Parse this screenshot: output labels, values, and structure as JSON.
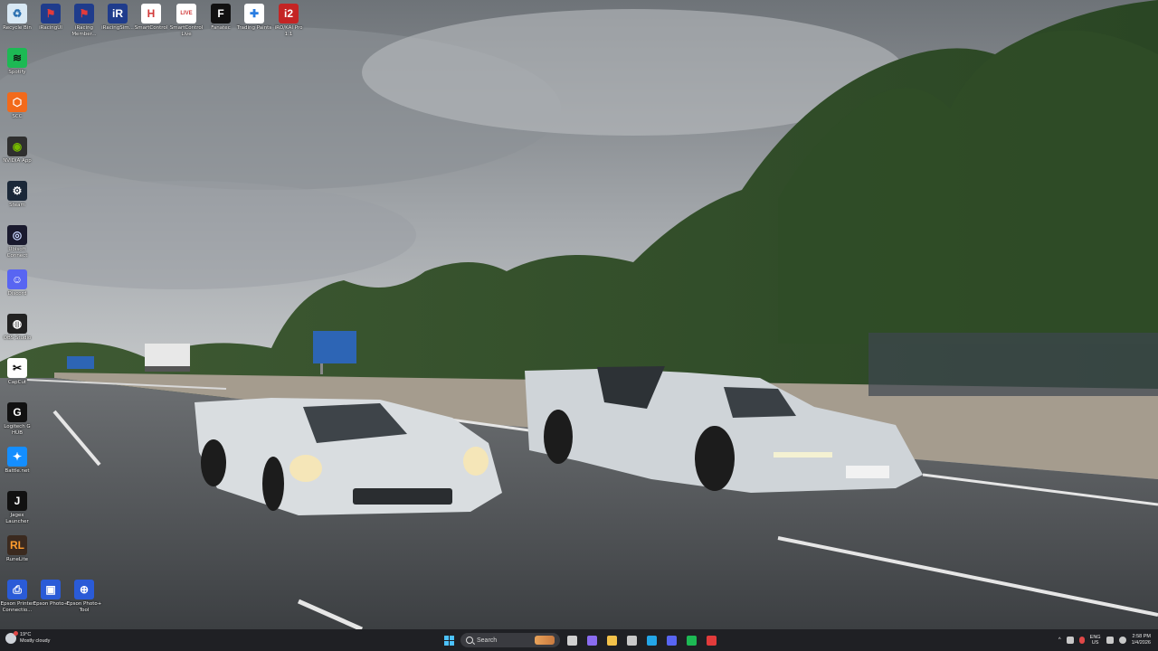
{
  "desktop_icons": [
    {
      "label": "Recycle Bin",
      "color": "#d8e8f4",
      "glyph": "♻",
      "fg": "#2a6fb0"
    },
    {
      "label": "iRacingUI",
      "color": "#1f3c8c",
      "glyph": "⚑",
      "fg": "#e23b3b"
    },
    {
      "label": "iRacing Member...",
      "color": "#1f3c8c",
      "glyph": "⚑",
      "fg": "#e23b3b"
    },
    {
      "label": "iRacingSim...",
      "color": "#1f3c8c",
      "glyph": "iR",
      "fg": "#ffffff"
    },
    {
      "label": "SmartControl",
      "color": "#ffffff",
      "glyph": "H",
      "fg": "#d23a3a"
    },
    {
      "label": "SmartControl Live",
      "color": "#ffffff",
      "glyph": "LIVE",
      "fg": "#d23a3a"
    },
    {
      "label": "Fanatec",
      "color": "#111111",
      "glyph": "F",
      "fg": "#ffffff"
    },
    {
      "label": "Trading Paints",
      "color": "#ffffff",
      "glyph": "✚",
      "fg": "#2a7de1"
    },
    {
      "label": "iRO/KAI Pro 1.1",
      "color": "#c42424",
      "glyph": "i2",
      "fg": "#ffffff"
    },
    {
      "label": "Spotify",
      "color": "#1db954",
      "glyph": "≋",
      "fg": "#111111"
    },
    {
      "label": "SCC",
      "color": "#f26a1b",
      "glyph": "⬡",
      "fg": "#ffffff"
    },
    {
      "label": "NVIDIA App",
      "color": "#2f2f2f",
      "glyph": "◉",
      "fg": "#76b900"
    },
    {
      "label": "Steam",
      "color": "#1b2838",
      "glyph": "⚙",
      "fg": "#ffffff"
    },
    {
      "label": "Ubisoft Connect",
      "color": "#1a1a2e",
      "glyph": "◎",
      "fg": "#c9d6ff"
    },
    {
      "label": "Discord",
      "color": "#5865f2",
      "glyph": "☺",
      "fg": "#ffffff"
    },
    {
      "label": "OBS Studio",
      "color": "#222222",
      "glyph": "◍",
      "fg": "#ffffff"
    },
    {
      "label": "CapCut",
      "color": "#ffffff",
      "glyph": "✂",
      "fg": "#000000"
    },
    {
      "label": "Logitech G HUB",
      "color": "#111111",
      "glyph": "G",
      "fg": "#ffffff"
    },
    {
      "label": "Battle.net",
      "color": "#148eff",
      "glyph": "✦",
      "fg": "#ffffff"
    },
    {
      "label": "Jagex Launcher",
      "color": "#111111",
      "glyph": "J",
      "fg": "#ffffff"
    },
    {
      "label": "RuneLite",
      "color": "#3b2a1f",
      "glyph": "RL",
      "fg": "#ff9d2e"
    },
    {
      "label": "Epson Printer Connectio...",
      "color": "#2a5bd7",
      "glyph": "⎙",
      "fg": "#ffffff"
    },
    {
      "label": "Epson Photo+",
      "color": "#2a5bd7",
      "glyph": "▣",
      "fg": "#ffffff"
    },
    {
      "label": "Epson Photo+ Tool",
      "color": "#2a5bd7",
      "glyph": "⊕",
      "fg": "#ffffff"
    }
  ],
  "taskbar": {
    "weather_temp": "19°C",
    "weather_desc": "Mostly cloudy",
    "search_placeholder": "Search",
    "apps": [
      {
        "name": "task-view",
        "color": "#d0d0d0"
      },
      {
        "name": "copilot",
        "color": "#8a6cf0"
      },
      {
        "name": "file-explorer",
        "color": "#f3c24a"
      },
      {
        "name": "calculator",
        "color": "#c9c9c9"
      },
      {
        "name": "edge",
        "color": "#23a6e8"
      },
      {
        "name": "discord",
        "color": "#5865f2"
      },
      {
        "name": "spotify",
        "color": "#1db954"
      },
      {
        "name": "iracing",
        "color": "#e23b3b"
      }
    ],
    "lang_line1": "ENG",
    "lang_line2": "US",
    "time": "2:58 PM",
    "date": "1/4/2026"
  }
}
